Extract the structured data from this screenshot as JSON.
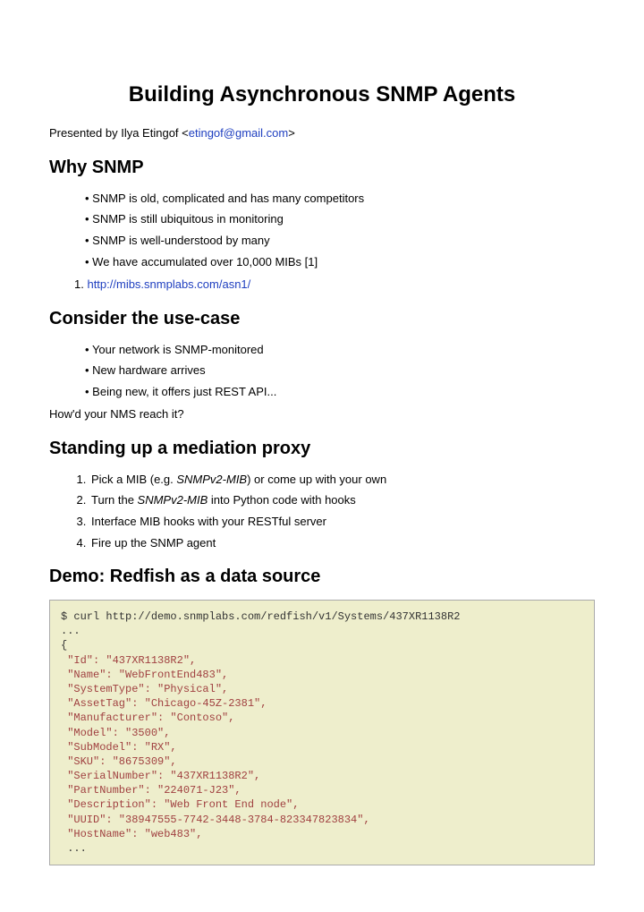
{
  "title": "Building Asynchronous SNMP Agents",
  "presented_prefix": "Presented by Ilya Etingof <",
  "presented_email": "etingof@gmail.com",
  "presented_suffix": ">",
  "why_heading": "Why SNMP",
  "why_bullets": [
    "SNMP is old, complicated and has many competitors",
    "SNMP is still ubiquitous in monitoring",
    "SNMP is well-understood by many",
    "We have accumulated over 10,000 MIBs [1]"
  ],
  "why_ref_prefix": "1. ",
  "why_ref_link": "http://mibs.snmplabs.com/asn1/",
  "usecase_heading": "Consider the use-case",
  "usecase_bullets": [
    "Your network is SNMP-monitored",
    "New hardware arrives",
    "Being new, it offers just REST API..."
  ],
  "usecase_question": "How'd your NMS reach it?",
  "proxy_heading": "Standing up a mediation proxy",
  "proxy_step1_a": "Pick a MIB (e.g. ",
  "proxy_step1_mib": "SNMPv2-MIB",
  "proxy_step1_b": ") or come up with your own",
  "proxy_step2_a": "Turn the ",
  "proxy_step2_mib": "SNMPv2-MIB",
  "proxy_step2_b": " into Python code with hooks",
  "proxy_step3": "Interface MIB hooks with your RESTful server",
  "proxy_step4": "Fire up the SNMP agent",
  "demo_heading": "Demo: Redfish as a data source",
  "code_cmd": "$ curl http://demo.snmplabs.com/redfish/v1/Systems/437XR1138R2",
  "code_dots_top": "...",
  "code_brace": "{",
  "code_lines": [
    " \"Id\": \"437XR1138R2\",",
    " \"Name\": \"WebFrontEnd483\",",
    " \"SystemType\": \"Physical\",",
    " \"AssetTag\": \"Chicago-45Z-2381\",",
    " \"Manufacturer\": \"Contoso\",",
    " \"Model\": \"3500\",",
    " \"SubModel\": \"RX\",",
    " \"SKU\": \"8675309\",",
    " \"SerialNumber\": \"437XR1138R2\",",
    " \"PartNumber\": \"224071-J23\",",
    " \"Description\": \"Web Front End node\",",
    " \"UUID\": \"38947555-7742-3448-3784-823347823834\",",
    " \"HostName\": \"web483\","
  ],
  "code_dots_bottom": " ..."
}
